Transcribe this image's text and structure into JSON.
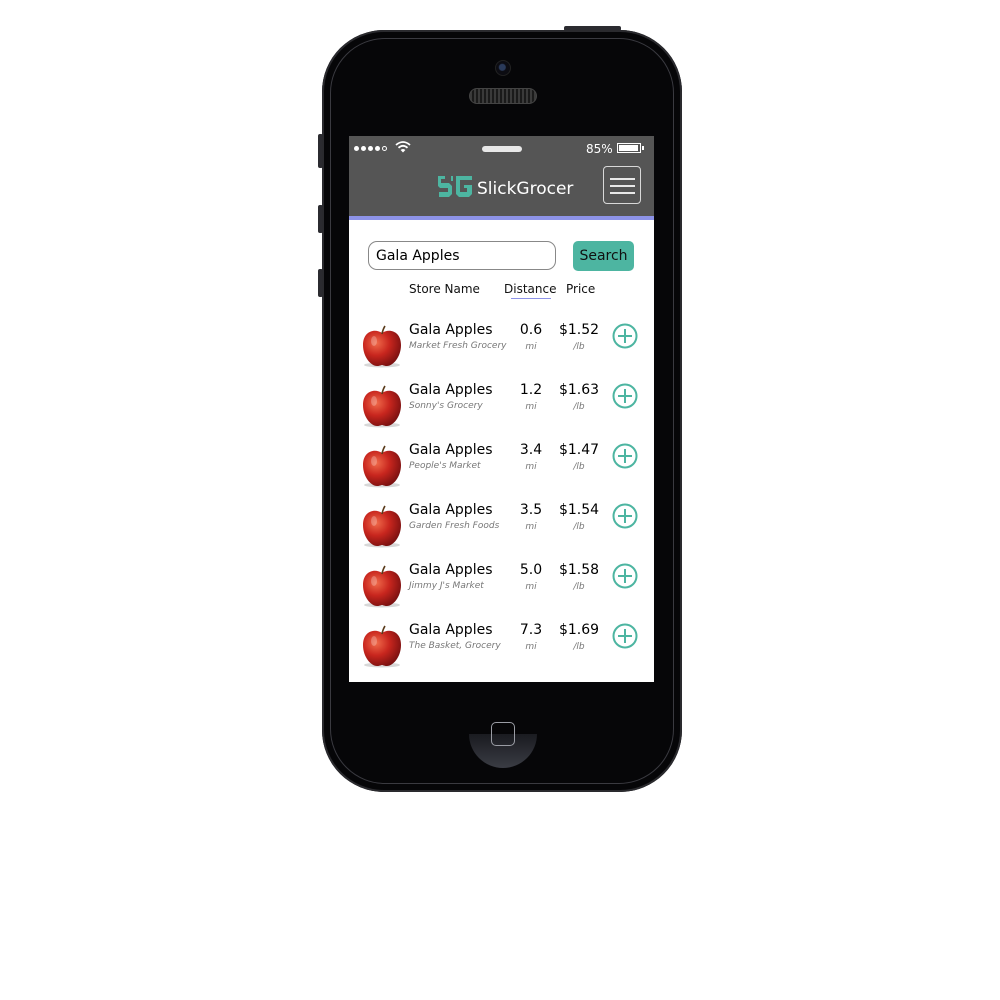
{
  "app": {
    "title": "SlickGrocer",
    "brand_color": "#4db5a1",
    "header_color": "#555555",
    "accent_underline": "#8d93e8"
  },
  "status_bar": {
    "battery": "85%"
  },
  "search": {
    "value": "Gala Apples",
    "button_label": "Search"
  },
  "columns": {
    "store_name": "Store Name",
    "distance": "Distance",
    "price": "Price"
  },
  "results": [
    {
      "item": "Gala Apples",
      "store": "Market Fresh Grocery",
      "distance": "0.6",
      "distance_unit": "mi",
      "price": "$1.52",
      "price_unit": "/lb"
    },
    {
      "item": "Gala Apples",
      "store": "Sonny's Grocery",
      "distance": "1.2",
      "distance_unit": "mi",
      "price": "$1.63",
      "price_unit": "/lb"
    },
    {
      "item": "Gala Apples",
      "store": "People's Market",
      "distance": "3.4",
      "distance_unit": "mi",
      "price": "$1.47",
      "price_unit": "/lb"
    },
    {
      "item": "Gala Apples",
      "store": "Garden Fresh Foods",
      "distance": "3.5",
      "distance_unit": "mi",
      "price": "$1.54",
      "price_unit": "/lb"
    },
    {
      "item": "Gala Apples",
      "store": "Jimmy J's Market",
      "distance": "5.0",
      "distance_unit": "mi",
      "price": "$1.58",
      "price_unit": "/lb"
    },
    {
      "item": "Gala Apples",
      "store": "The Basket, Grocery",
      "distance": "7.3",
      "distance_unit": "mi",
      "price": "$1.69",
      "price_unit": "/lb"
    }
  ]
}
